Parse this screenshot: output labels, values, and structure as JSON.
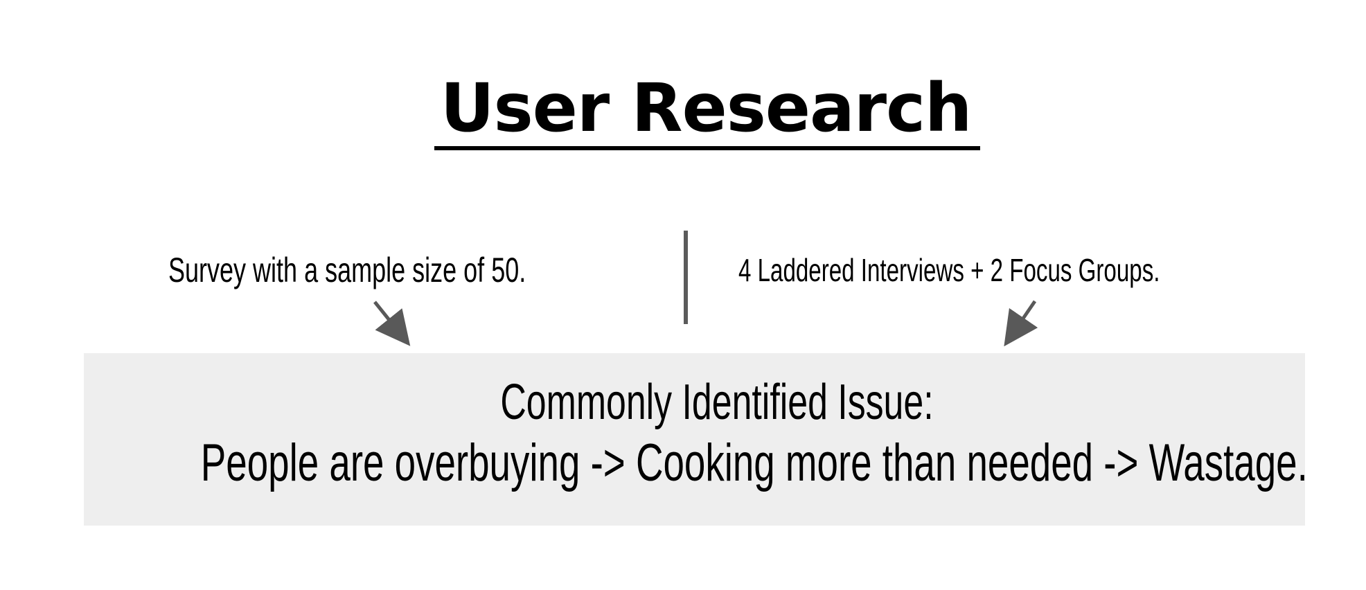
{
  "slide": {
    "title": "User Research",
    "sources": {
      "left": "Survey with a sample size of 50.",
      "right": "4 Laddered Interviews + 2 Focus Groups."
    },
    "finding": {
      "heading": "Commonly Identified Issue:",
      "chain": "People are overbuying -> Cooking more than needed -> Wastage."
    }
  },
  "colors": {
    "text": "#000000",
    "divider": "#5b5b5b",
    "arrow": "#595959",
    "finding_background": "#eeeeee"
  }
}
